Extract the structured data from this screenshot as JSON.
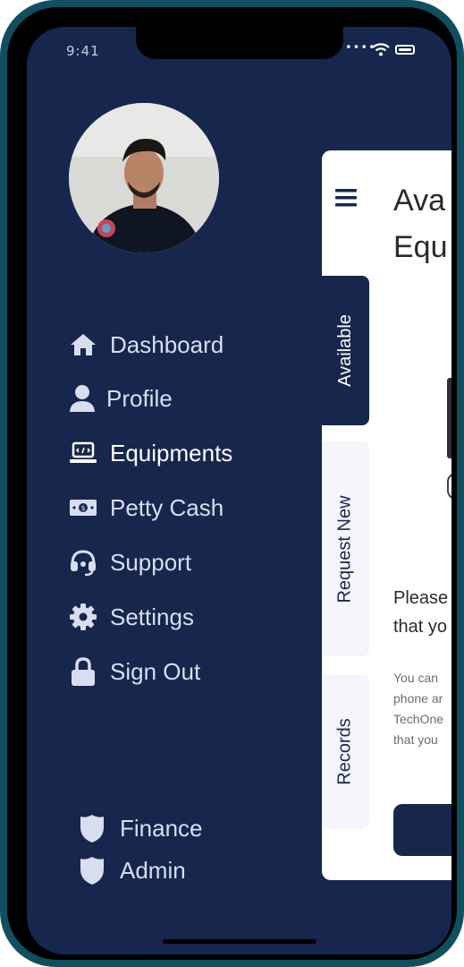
{
  "status_bar": {
    "time": "9:41"
  },
  "profile": {
    "avatar_alt": "profile photo"
  },
  "menu": {
    "items": [
      {
        "label": "Dashboard",
        "icon": "home-icon"
      },
      {
        "label": "Profile",
        "icon": "user-icon"
      },
      {
        "label": "Equipments",
        "icon": "laptop-icon",
        "active": true
      },
      {
        "label": "Petty Cash",
        "icon": "cash-icon"
      },
      {
        "label": "Support",
        "icon": "headset-icon"
      },
      {
        "label": "Settings",
        "icon": "gear-icon"
      },
      {
        "label": "Sign Out",
        "icon": "lock-icon"
      }
    ]
  },
  "roles": {
    "items": [
      {
        "label": "Finance",
        "icon": "shield-icon"
      },
      {
        "label": "Admin",
        "icon": "shield-icon"
      }
    ]
  },
  "card": {
    "title_line1": "Ava",
    "title_line2": "Equ",
    "tabs": [
      {
        "label": "Available",
        "active": true
      },
      {
        "label": "Request New"
      },
      {
        "label": "Records"
      }
    ],
    "message_line1": "Please",
    "message_line2": "that yo",
    "desc_line1": "You can",
    "desc_line2": "phone ar",
    "desc_line3": "TechOne",
    "desc_line4": "that you"
  },
  "colors": {
    "frame": "#0f4f5f",
    "drawer_bg": "#16264d",
    "card_bg": "#ffffff",
    "tab_inactive_bg": "#f4f6fb",
    "menu_text": "#d8def0"
  }
}
